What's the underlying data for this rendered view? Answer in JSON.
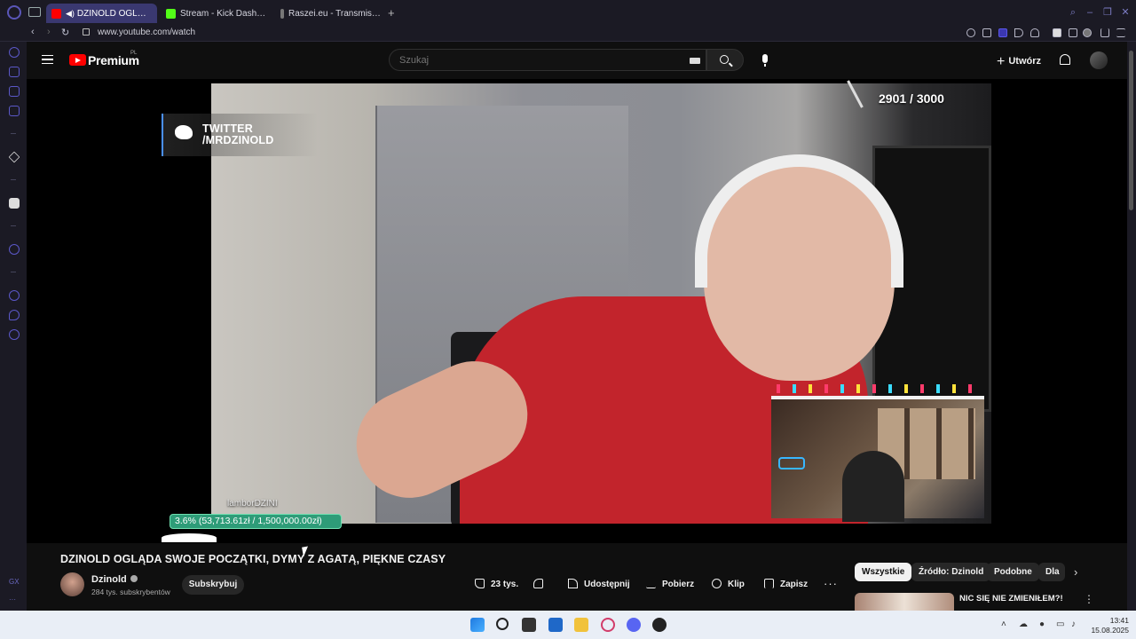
{
  "browser": {
    "tabs": [
      {
        "label": "DZINOLD OGLĄDA SW",
        "active": true,
        "favicon_color": "#ff0000",
        "has_audio": true
      },
      {
        "label": "Stream - Kick Dashboard",
        "active": false,
        "favicon_color": "#53fc18"
      },
      {
        "label": "Raszei.eu - Transmisje, N",
        "active": false,
        "favicon_color": "#888888"
      }
    ],
    "new_tab": "+",
    "url": "www.youtube.com/watch",
    "accent_color": "#5a56b8"
  },
  "sidebar": {
    "items": [
      "history-icon",
      "bag-icon",
      "wallet-icon",
      "music-icon",
      "aria-icon",
      "discord-icon",
      "player-icon",
      "clock-icon",
      "messenger-icon",
      "settings-icon"
    ],
    "gx_label": "GX",
    "more_label": "···"
  },
  "header": {
    "brand": "Premium",
    "region": "PL",
    "search_placeholder": "Szukaj",
    "create_label": "Utwórz"
  },
  "player": {
    "stream_social": "TWITTER\n/MRDZINOLD",
    "goal_counter": "2901 / 3000",
    "viewer_name": "lamborDZINI",
    "donation_progress_text": "3.6% (53,713.61zł / 1,500,000.00zł)",
    "donation_progress": 0.036
  },
  "video": {
    "title": "DZINOLD OGLĄDA SWOJE POCZĄTKI, DYMY Z AGATĄ, PIĘKNE CZASY",
    "channel": "Dzinold",
    "subscribers": "284 tys. subskrybentów",
    "subscribe_label": "Subskrybuj",
    "likes": "23 tys.",
    "share_label": "Udostępnij",
    "download_label": "Pobierz",
    "clip_label": "Klip",
    "save_label": "Zapisz",
    "more_label": "···"
  },
  "recommendations": {
    "chips": [
      "Wszystkie",
      "Źródło: Dzinold",
      "Podobne",
      "Dla"
    ],
    "items": [
      {
        "title": "NIC SIĘ NIE ZMIENIŁEM?!"
      }
    ]
  },
  "taskbar": {
    "time": "13:41",
    "date": "15.08.2025"
  }
}
